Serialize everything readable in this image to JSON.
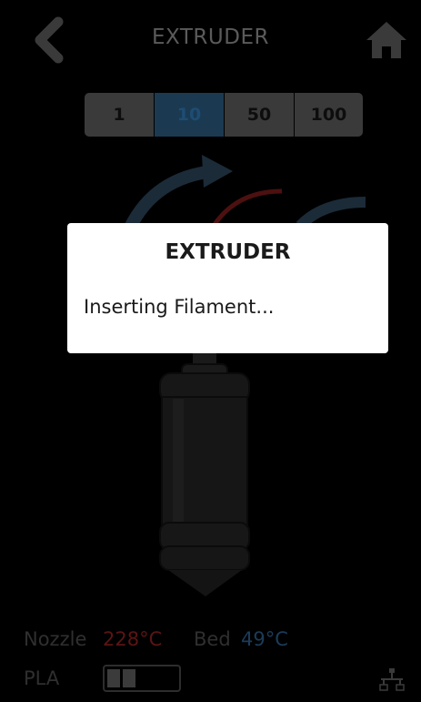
{
  "header": {
    "title": "EXTRUDER",
    "back_icon": "chevron-left-icon",
    "home_icon": "home-icon"
  },
  "step_selector": {
    "options": [
      "1",
      "10",
      "50",
      "100"
    ],
    "selected": "10"
  },
  "dialog": {
    "title": "EXTRUDER",
    "message": "Inserting Filament..."
  },
  "status": {
    "nozzle_label": "Nozzle",
    "nozzle_temp": "228°C",
    "bed_label": "Bed",
    "bed_temp": "49°C",
    "material": "PLA",
    "filament_level_fraction": 0.4,
    "network_icon": "network-icon"
  },
  "colors": {
    "accent_blue": "#1d4d74",
    "nozzle_red": "#5c1414",
    "bed_blue": "#1b3c5a",
    "dialog_bg": "#ffffff",
    "background": "#000000"
  }
}
